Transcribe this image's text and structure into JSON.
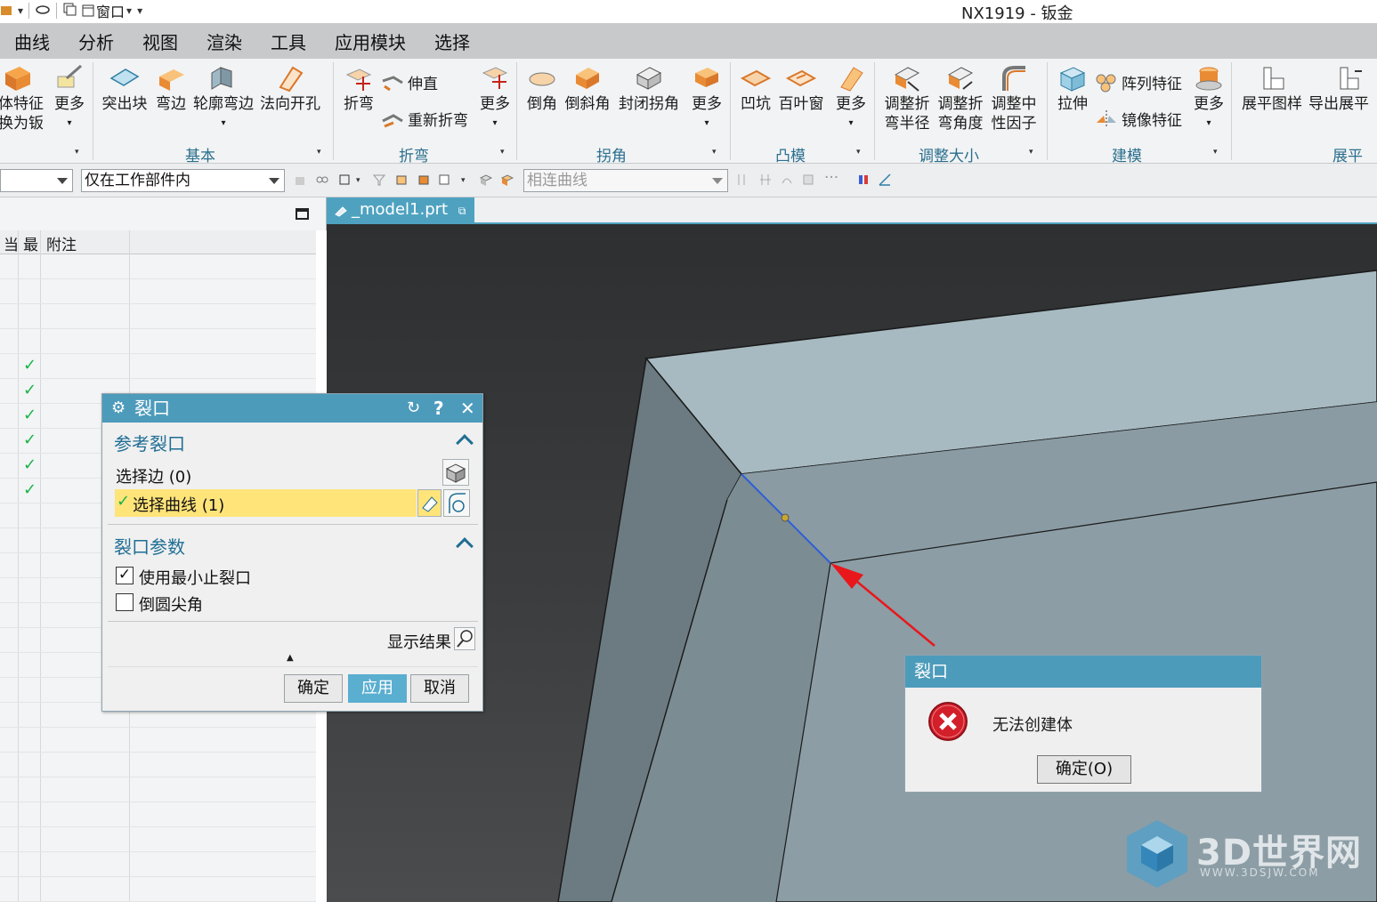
{
  "title_bar": {
    "title": "NX1919 - 钣金",
    "quick_access": {
      "window_menu_label": "窗口"
    }
  },
  "menubar": {
    "items": [
      "曲线",
      "分析",
      "视图",
      "渲染",
      "工具",
      "应用模块",
      "选择"
    ]
  },
  "ribbon": {
    "buttons": {
      "convert_line1": "体特征",
      "convert_line2": "换为钣",
      "more1": "更多",
      "tab": "突出块",
      "flange": "弯边",
      "contour_flange": "轮廓弯边",
      "normal_cutout": "法向开孔",
      "bend": "折弯",
      "unbend": "伸直",
      "rebend": "重新折弯",
      "more2": "更多",
      "break_corner": "倒角",
      "chamfer": "倒斜角",
      "closed_corner": "封闭拐角",
      "more3": "更多",
      "dimple": "凹坑",
      "louver": "百叶窗",
      "more4": "更多",
      "resize_bend_radius_1": "调整折",
      "resize_bend_radius_2": "弯半径",
      "resize_bend_angle_1": "调整折",
      "resize_bend_angle_2": "弯角度",
      "resize_neutral_1": "调整中",
      "resize_neutral_2": "性因子",
      "extrude": "拉伸",
      "pattern_feature": "阵列特征",
      "mirror_feature": "镜像特征",
      "more5": "更多",
      "flat_pattern": "展平图样",
      "export_flat": "导出展平"
    },
    "groups": [
      "基本",
      "折弯",
      "拐角",
      "凸模",
      "调整大小",
      "建模",
      "展平图"
    ]
  },
  "selection_bar": {
    "scope_value": "仅在工作部件内",
    "curve_rule_value": "相连曲线"
  },
  "navigator": {
    "columns": [
      "当",
      "最",
      "附注"
    ],
    "checked_rows": 6
  },
  "viewport": {
    "tab_label": "_model1.prt"
  },
  "rip_dialog": {
    "title": "裂口",
    "section_reference": "参考裂口",
    "select_edge": "选择边 (0)",
    "select_curve": "选择曲线 (1)",
    "section_params": "裂口参数",
    "use_min_relief": "使用最小止裂口",
    "use_min_relief_checked": true,
    "round_corner": "倒圆尖角",
    "round_corner_checked": false,
    "show_result": "显示结果",
    "ok": "确定",
    "apply": "应用",
    "cancel": "取消"
  },
  "error_dialog": {
    "title": "裂口",
    "message": "无法创建体",
    "ok": "确定(O)"
  },
  "watermark": {
    "brand": "3D世界网",
    "url": "WWW.3DSJW.COM"
  },
  "colors": {
    "accent": "#4d9bbb",
    "highlight": "#ffe47a",
    "check_green": "#1bb34a",
    "arrow_red": "#e8171c",
    "error_red": "#d21f2a"
  }
}
